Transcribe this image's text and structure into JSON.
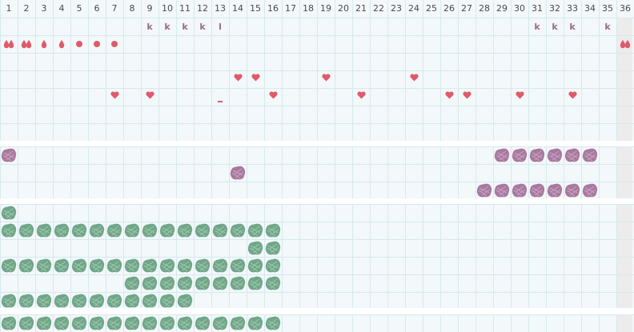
{
  "colors": {
    "grid_bg": "#f3f8fa",
    "grid_line": "#d7e9ee",
    "band_sep": "#ffffff",
    "last_col_bg": "#ececec",
    "marker_red": "#e05a6a",
    "k_purple": "#9b6a8f",
    "purple_blob": "#a9789f",
    "green_blob": "#6fa788"
  },
  "header": {
    "columns": [
      "1",
      "2",
      "3",
      "4",
      "5",
      "6",
      "7",
      "8",
      "9",
      "10",
      "11",
      "12",
      "13",
      "14",
      "15",
      "16",
      "17",
      "18",
      "19",
      "20",
      "21",
      "22",
      "23",
      "24",
      "25",
      "26",
      "27",
      "28",
      "29",
      "30",
      "31",
      "32",
      "33",
      "34",
      "35",
      "36"
    ]
  },
  "letter_row": [
    {
      "col": 9,
      "text": "k"
    },
    {
      "col": 10,
      "text": "k"
    },
    {
      "col": 11,
      "text": "k"
    },
    {
      "col": 12,
      "text": "k"
    },
    {
      "col": 13,
      "text": "l"
    },
    {
      "col": 31,
      "text": "k"
    },
    {
      "col": 32,
      "text": "k"
    },
    {
      "col": 33,
      "text": "k"
    },
    {
      "col": 35,
      "text": "k"
    }
  ],
  "drop_row": [
    {
      "col": 1,
      "icon": "double-drop-icon"
    },
    {
      "col": 2,
      "icon": "double-drop-icon"
    },
    {
      "col": 3,
      "icon": "drop-icon"
    },
    {
      "col": 4,
      "icon": "drop-icon"
    },
    {
      "col": 5,
      "icon": "dot-icon"
    },
    {
      "col": 6,
      "icon": "dot-icon"
    },
    {
      "col": 7,
      "icon": "dot-icon"
    },
    {
      "col": 36,
      "icon": "double-drop-icon"
    }
  ],
  "heart_row_1": [
    14,
    15,
    19,
    24
  ],
  "heart_row_2": [
    7,
    9,
    16,
    21,
    26,
    27,
    30,
    33
  ],
  "dash_marks": [
    {
      "col": 13,
      "row": 5
    }
  ],
  "purple_blobs": [
    {
      "col": 1,
      "row": 8
    },
    {
      "col": 29,
      "row": 8
    },
    {
      "col": 30,
      "row": 8
    },
    {
      "col": 31,
      "row": 8
    },
    {
      "col": 32,
      "row": 8
    },
    {
      "col": 33,
      "row": 8
    },
    {
      "col": 34,
      "row": 8
    },
    {
      "col": 14,
      "row": 9
    },
    {
      "col": 28,
      "row": 10
    },
    {
      "col": 29,
      "row": 10
    },
    {
      "col": 30,
      "row": 10
    },
    {
      "col": 31,
      "row": 10
    },
    {
      "col": 32,
      "row": 10
    },
    {
      "col": 33,
      "row": 10
    },
    {
      "col": 34,
      "row": 10
    }
  ],
  "green_rows": [
    {
      "row": 12,
      "cols": [
        1
      ]
    },
    {
      "row": 13,
      "cols": [
        1,
        2,
        3,
        4,
        5,
        6,
        7,
        8,
        9,
        10,
        11,
        12,
        13,
        14,
        15,
        16
      ]
    },
    {
      "row": 14,
      "cols": [
        15,
        16
      ]
    },
    {
      "row": 15,
      "cols": [
        1,
        2,
        3,
        4,
        5,
        6,
        7,
        8,
        9,
        10,
        11,
        12,
        13,
        14,
        15,
        16
      ]
    },
    {
      "row": 16,
      "cols": [
        8,
        9,
        10,
        11,
        12,
        13,
        14,
        15,
        16
      ]
    },
    {
      "row": 17,
      "cols": [
        1,
        2,
        3,
        4,
        5,
        6,
        7,
        8,
        9,
        10,
        11
      ]
    },
    {
      "row": 18,
      "cols": [
        1,
        2,
        3,
        4,
        5,
        6,
        7,
        8,
        9,
        10,
        11,
        12,
        13,
        14,
        15,
        16
      ]
    }
  ]
}
